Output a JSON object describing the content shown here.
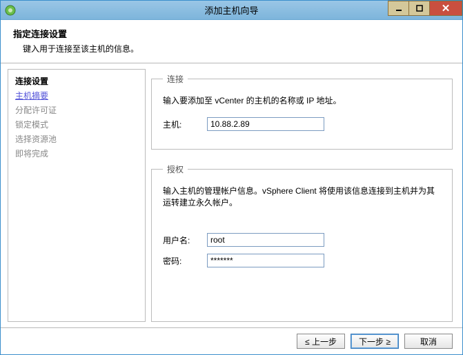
{
  "window": {
    "title": "添加主机向导"
  },
  "header": {
    "title": "指定连接设置",
    "description": "键入用于连接至该主机的信息。"
  },
  "sidebar": {
    "items": [
      {
        "label": "连接设置"
      },
      {
        "label": "主机摘要"
      },
      {
        "label": "分配许可证"
      },
      {
        "label": "锁定模式"
      },
      {
        "label": "选择资源池"
      },
      {
        "label": "即将完成"
      }
    ]
  },
  "connection": {
    "legend": "连接",
    "description": "输入要添加至 vCenter 的主机的名称或 IP 地址。",
    "host_label": "主机:",
    "host_value": "10.88.2.89"
  },
  "auth": {
    "legend": "授权",
    "description": "输入主机的管理帐户信息。vSphere Client 将使用该信息连接到主机并为其运转建立永久帐户。",
    "username_label": "用户名:",
    "username_value": "root",
    "password_label": "密码:",
    "password_value": "*******"
  },
  "footer": {
    "back": "≤ 上一步",
    "next": "下一步 ≥",
    "cancel": "取消"
  }
}
